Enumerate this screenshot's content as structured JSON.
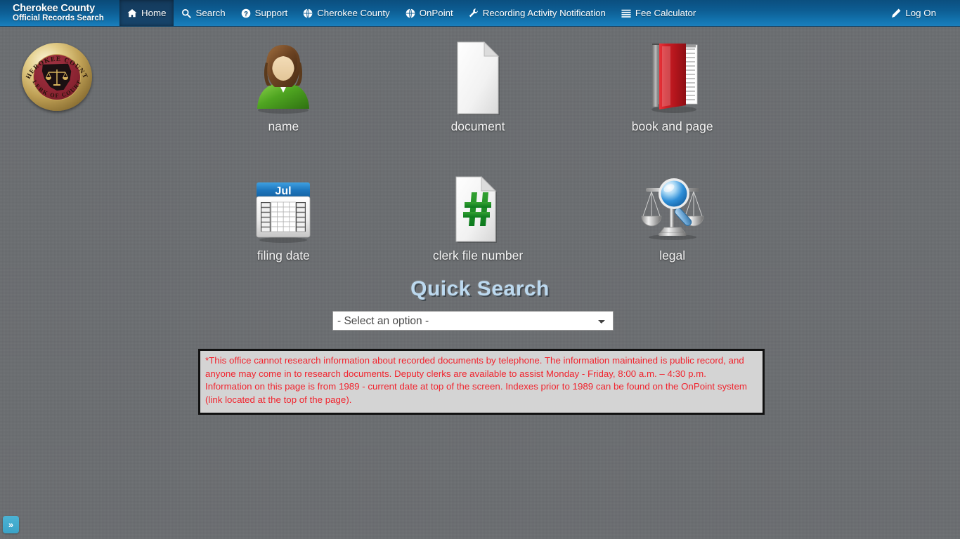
{
  "navbar": {
    "brand_title": "Cherokee County",
    "brand_subtitle": "Official Records Search",
    "items": [
      {
        "label": "Home",
        "icon": "home-icon",
        "active": true
      },
      {
        "label": "Search",
        "icon": "search-icon",
        "active": false
      },
      {
        "label": "Support",
        "icon": "question-circle-icon",
        "active": false
      },
      {
        "label": "Cherokee County",
        "icon": "globe-icon",
        "active": false
      },
      {
        "label": "OnPoint",
        "icon": "globe-icon",
        "active": false
      },
      {
        "label": "Recording Activity Notification",
        "icon": "wrench-icon",
        "active": false
      },
      {
        "label": "Fee Calculator",
        "icon": "list-icon",
        "active": false
      }
    ],
    "logon_label": "Log On",
    "logon_icon": "pencil-icon",
    "bg_color_top": "#0b4f7f",
    "bg_color_bottom": "#1a7fbd",
    "active_color": "#143a5c"
  },
  "seal": {
    "top_text": "CHEROKEE COUNTY",
    "bottom_text": "CLERK OF COURTS",
    "gold_color": "#bfa055",
    "maroon_color": "#8d2533"
  },
  "search_tiles": [
    {
      "label": "name",
      "icon": "person-icon"
    },
    {
      "label": "document",
      "icon": "document-page-icon"
    },
    {
      "label": "book and page",
      "icon": "red-book-icon"
    },
    {
      "label": "filing date",
      "icon": "calendar-icon"
    },
    {
      "label": "clerk file number",
      "icon": "hash-document-icon"
    },
    {
      "label": "legal",
      "icon": "scales-magnifier-icon"
    }
  ],
  "calendar": {
    "month_label": "Jul"
  },
  "quick_search": {
    "title": "Quick Search",
    "select_value": "- Select an option -",
    "options": [
      "- Select an option -"
    ],
    "title_color": "#bcd9ef"
  },
  "notice": {
    "line1": "*This office cannot research information about recorded documents by telephone. The information maintained is public record, and anyone may come in to research documents. Deputy clerks are available to assist Monday - Friday, 8:00 a.m. – 4:30 p.m.",
    "line2": "Information on this page is from 1989 - current date at top of the screen. Indexes prior to 1989 can be found on the OnPoint system (link located at the top of the page).",
    "text_color": "#f1242e",
    "bg_color": "#d4d4d4"
  },
  "corner_toggle": {
    "label": "»",
    "color": "#4cb3d4"
  },
  "page": {
    "background_color": "#6b6e71"
  }
}
